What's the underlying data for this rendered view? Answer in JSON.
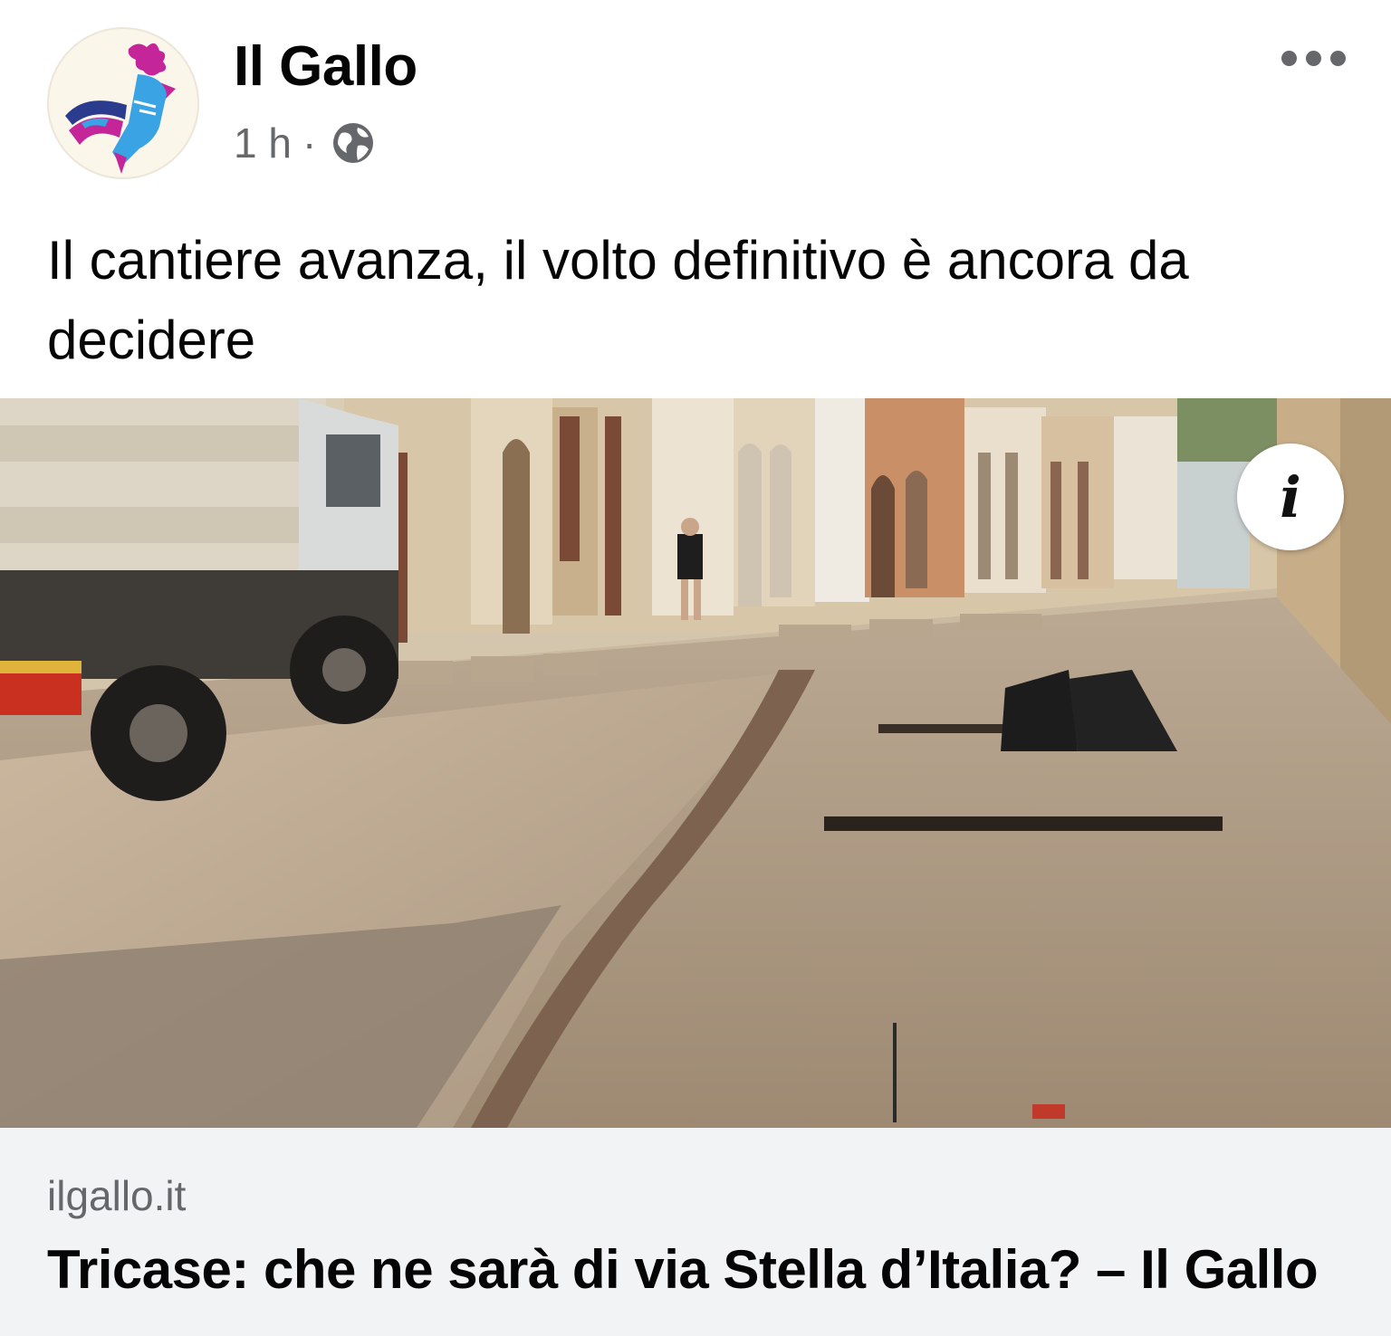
{
  "post": {
    "page_name": "Il Gallo",
    "time": "1 h",
    "separator": "·",
    "audience_icon": "globe-icon",
    "more_icon": "more-options-icon",
    "text": "Il cantiere avanza, il volto definitivo è ancora da decidere"
  },
  "media": {
    "image": "street-construction-photo",
    "info_label": "i"
  },
  "link_preview": {
    "domain": "ilgallo.it",
    "title": "Tricase: che ne sarà di via Stella d’Italia? – Il Gallo"
  },
  "colors": {
    "text_primary": "#050505",
    "text_secondary": "#65676b",
    "link_background": "#f2f3f5",
    "logo_magenta": "#c4269a",
    "logo_blue": "#3aa3e3",
    "logo_navy": "#2b3c8f"
  }
}
